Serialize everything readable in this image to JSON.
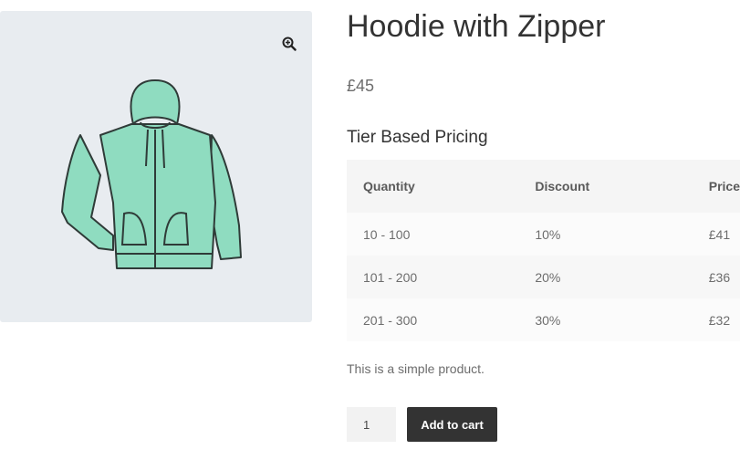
{
  "gallery": {
    "image_subject": "mint green zip-up hoodie",
    "zoom_icon": "zoom-in-icon"
  },
  "product": {
    "title": "Hoodie with Zipper",
    "price": "£45",
    "description": "This is a simple product."
  },
  "tier_pricing": {
    "heading": "Tier Based Pricing",
    "columns": [
      "Quantity",
      "Discount",
      "Price"
    ],
    "rows": [
      [
        "10 - 100",
        "10%",
        "£41"
      ],
      [
        "101 - 200",
        "20%",
        "£36"
      ],
      [
        "201 - 300",
        "30%",
        "£32"
      ]
    ]
  },
  "cart": {
    "quantity": "1",
    "add_label": "Add to cart"
  },
  "colors": {
    "gallery_bg": "#e8ecf0",
    "hoodie_fill": "#8fdcc0",
    "button_bg": "#333333"
  }
}
